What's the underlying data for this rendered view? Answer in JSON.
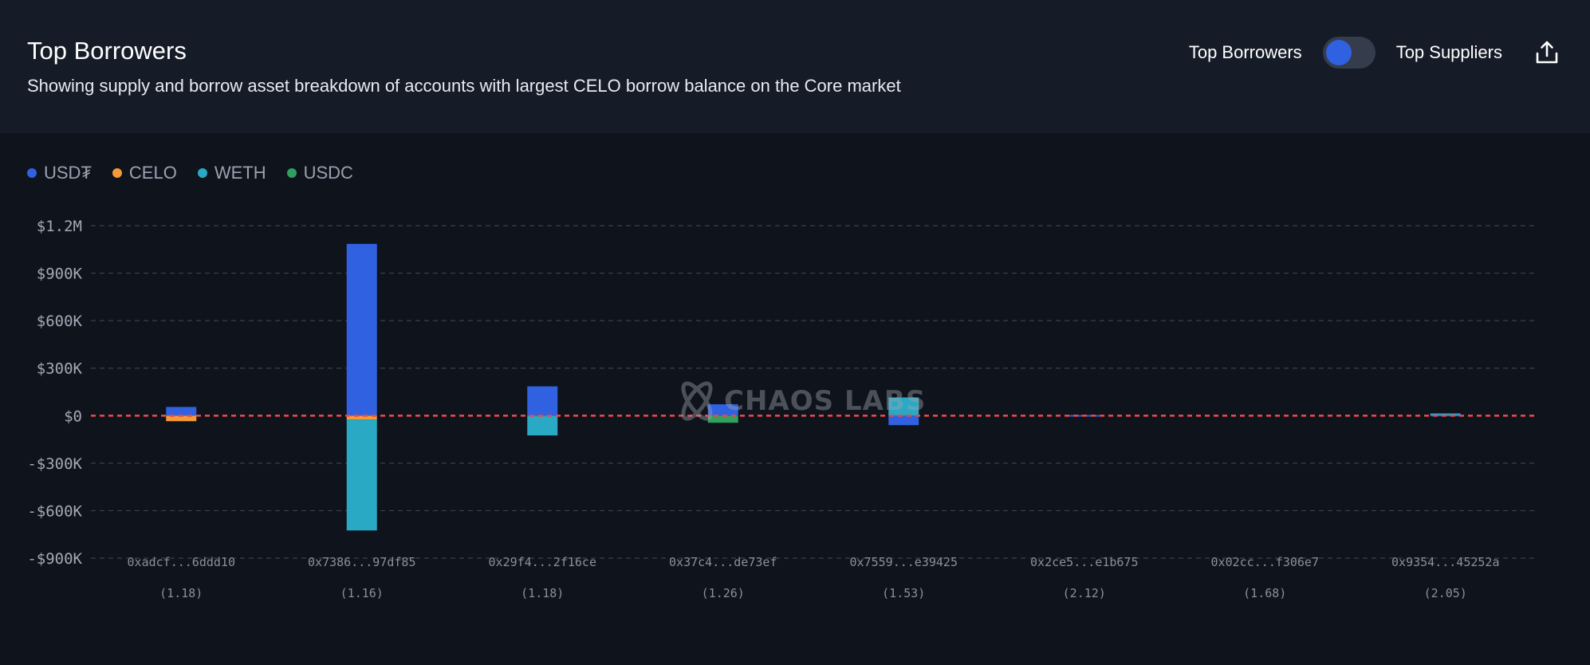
{
  "header": {
    "title": "Top Borrowers",
    "subtitle": "Showing supply and borrow asset breakdown of accounts with largest CELO borrow balance on the Core market"
  },
  "controls": {
    "left_label": "Top Borrowers",
    "right_label": "Top Suppliers",
    "toggle_state": "Top Borrowers",
    "export_icon": "share-upload-icon"
  },
  "legend": [
    {
      "label": "USD₮",
      "color": "#2f61e0"
    },
    {
      "label": "CELO",
      "color": "#f59a37"
    },
    {
      "label": "WETH",
      "color": "#2aa9c4"
    },
    {
      "label": "USDC",
      "color": "#2fa05e"
    }
  ],
  "watermark": {
    "text": "CHAOS LABS"
  },
  "chart_data": {
    "type": "bar",
    "stacked": true,
    "grid": true,
    "legend_position": "top-left",
    "ylim": [
      -900000,
      1200000
    ],
    "yticks": [
      {
        "value": 1200000,
        "label": "$1.2M"
      },
      {
        "value": 900000,
        "label": "$900K"
      },
      {
        "value": 600000,
        "label": "$600K"
      },
      {
        "value": 300000,
        "label": "$300K"
      },
      {
        "value": 0,
        "label": "$0"
      },
      {
        "value": -300000,
        "label": "-$300K"
      },
      {
        "value": -600000,
        "label": "-$600K"
      },
      {
        "value": -900000,
        "label": "-$900K"
      }
    ],
    "categories": [
      "0xadcf...6ddd10",
      "0x7386...97df85",
      "0x29f4...2f16ce",
      "0x37c4...de73ef",
      "0x7559...e39425",
      "0x2ce5...e1b675",
      "0x02cc...f306e7",
      "0x9354...45252a"
    ],
    "category_sublabels": [
      "(1.18)",
      "(1.16)",
      "(1.18)",
      "(1.26)",
      "(1.53)",
      "(2.12)",
      "(1.68)",
      "(2.05)"
    ],
    "zero_line_color": "#e5484d",
    "series": [
      {
        "name": "USD₮",
        "color": "#2f61e0",
        "values": [
          55000,
          1085000,
          185000,
          72000,
          -60000,
          4000,
          0,
          6000
        ]
      },
      {
        "name": "CELO",
        "color": "#f59a37",
        "values": [
          -35000,
          -25000,
          0,
          0,
          0,
          0,
          0,
          0
        ]
      },
      {
        "name": "WETH",
        "color": "#2aa9c4",
        "values": [
          0,
          -700000,
          -125000,
          0,
          115000,
          0,
          0,
          8000
        ]
      },
      {
        "name": "USDC",
        "color": "#2fa05e",
        "values": [
          0,
          0,
          0,
          -45000,
          0,
          0,
          0,
          0
        ]
      }
    ]
  }
}
